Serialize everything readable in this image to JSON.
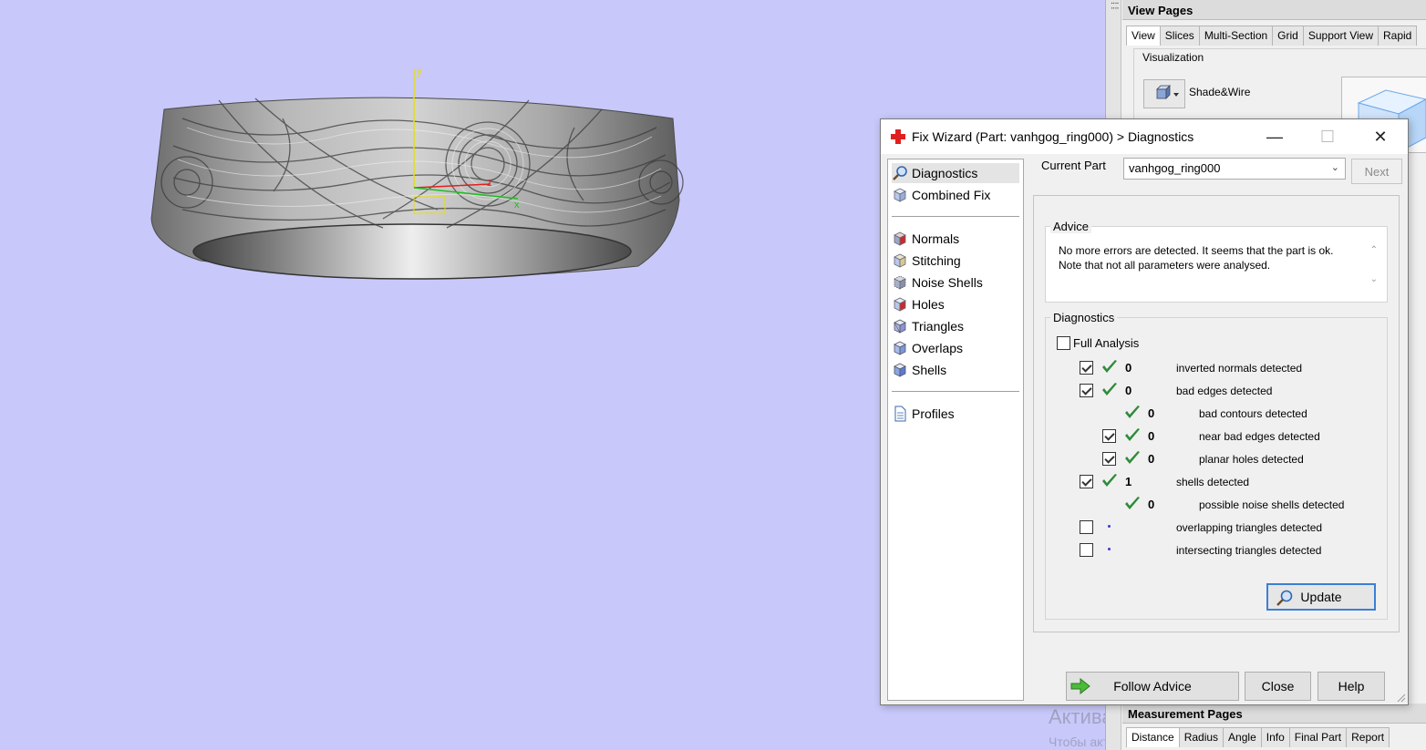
{
  "viewport": {
    "axis_y": "y",
    "axis_z": "z",
    "axis_x": "x",
    "watermark": "Активация Windows",
    "watermark_sub": "Чтобы активировать Windows, перейдите в раздел"
  },
  "view_pages": {
    "title": "View Pages",
    "tabs": [
      "View",
      "Slices",
      "Multi-Section",
      "Grid",
      "Support View",
      "Rapid"
    ],
    "active_tab": "View",
    "group_label": "Visualization",
    "shade_mode": "Shade&Wire"
  },
  "measurement_pages": {
    "title": "Measurement Pages",
    "tabs": [
      "Distance",
      "Radius",
      "Angle",
      "Info",
      "Final Part",
      "Report"
    ],
    "active_tab": "Distance"
  },
  "dialog": {
    "title": "Fix Wizard (Part: vanhgog_ring000) > Diagnostics",
    "nav": {
      "top": [
        "Diagnostics",
        "Combined Fix"
      ],
      "fixes": [
        "Normals",
        "Stitching",
        "Noise Shells",
        "Holes",
        "Triangles",
        "Overlaps",
        "Shells"
      ],
      "bottom": [
        "Profiles"
      ]
    },
    "current_part_label": "Current Part",
    "current_part_value": "vanhgog_ring000",
    "next_label": "Next",
    "advice_label": "Advice",
    "advice_text": "No more errors are detected. It seems that the part is ok. Note that not all parameters were analysed.",
    "diagnostics_label": "Diagnostics",
    "full_analysis_label": "Full Analysis",
    "rows": [
      {
        "checkbox": "checked",
        "status": "ok",
        "count": "0",
        "text": "inverted normals detected",
        "indent": 0
      },
      {
        "checkbox": "checked",
        "status": "ok",
        "count": "0",
        "text": "bad edges detected",
        "indent": 0
      },
      {
        "checkbox": "none",
        "status": "ok",
        "count": "0",
        "text": "bad contours detected",
        "indent": 1
      },
      {
        "checkbox": "checked",
        "status": "ok",
        "count": "0",
        "text": "near bad edges detected",
        "indent": 1
      },
      {
        "checkbox": "checked",
        "status": "ok",
        "count": "0",
        "text": "planar holes detected",
        "indent": 1
      },
      {
        "checkbox": "checked",
        "status": "ok",
        "count": "1",
        "text": "shells detected",
        "indent": 0
      },
      {
        "checkbox": "none",
        "status": "ok",
        "count": "0",
        "text": "possible noise shells detected",
        "indent": 1
      },
      {
        "checkbox": "unchecked",
        "status": "dot",
        "count": "",
        "text": "overlapping triangles detected",
        "indent": 0
      },
      {
        "checkbox": "unchecked",
        "status": "dot",
        "count": "",
        "text": "intersecting triangles detected",
        "indent": 0
      }
    ],
    "update_label": "Update",
    "follow_advice_label": "Follow Advice",
    "close_label": "Close",
    "help_label": "Help"
  },
  "colors": {
    "viewport_bg": "#c8c8fa",
    "tick_green": "#2e8b3a",
    "accent_blue": "#3c7fd4",
    "wizard_red": "#e02020"
  }
}
